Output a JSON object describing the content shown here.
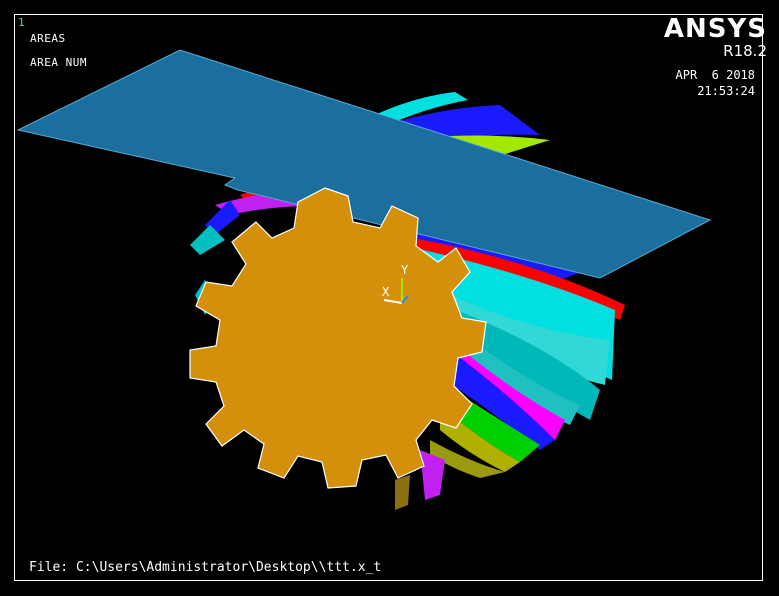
{
  "window": {
    "number": "1"
  },
  "plot_labels": {
    "line1": "AREAS",
    "line2": "AREA NUM"
  },
  "brand": {
    "name": "ANSYS",
    "version": "R18.2"
  },
  "timestamp": {
    "date": "APR  6 2018",
    "time": "21:53:24"
  },
  "triad": {
    "x": "X",
    "y": "Y"
  },
  "file": {
    "label": "File: C:\\Users\\Administrator\\Desktop\\\\ttt.x_t"
  },
  "colors": {
    "background": "#000000",
    "gear_face": "#d4900a",
    "plane": "#1b6f9e",
    "tooth_colors": [
      "#00e0e0",
      "#ff0000",
      "#1a1aff",
      "#a3e800",
      "#c020f0",
      "#00c0c0",
      "#ff00ff",
      "#00d000",
      "#b0b000",
      "#00a0ff"
    ]
  }
}
